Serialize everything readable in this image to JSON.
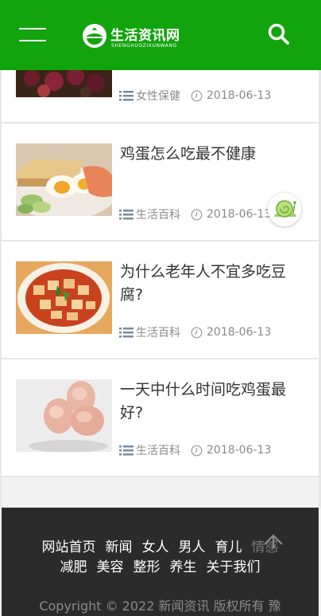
{
  "header": {
    "logo_title": "生活资讯网",
    "logo_subtitle": "SHENGHUOZIXUNWANG",
    "brand_color": "#12a40c",
    "menu_icon": "hamburger-menu-icon",
    "search_icon": "search-icon"
  },
  "articles": [
    {
      "title": "",
      "category": "女性保健",
      "date": "2018-06-13",
      "thumb": "berries-photo"
    },
    {
      "title": "鸡蛋怎么吃最不健康",
      "category": "生活百科",
      "date": "2018-06-13",
      "thumb": "eggs-toast-photo"
    },
    {
      "title": "为什么老年人不宜多吃豆腐?",
      "category": "生活百科",
      "date": "2018-06-13",
      "thumb": "mapo-tofu-photo"
    },
    {
      "title": "一天中什么时间吃鸡蛋最好?",
      "category": "生活百科",
      "date": "2018-06-13",
      "thumb": "raw-eggs-photo"
    }
  ],
  "footer": {
    "nav_row1": [
      "网站首页",
      "新闻",
      "女人",
      "男人",
      "育儿",
      "情感"
    ],
    "nav_row2": [
      "减肥",
      "美容",
      "整形",
      "养生",
      "关于我们"
    ],
    "copyright": "Copyright © 2022 新闻资讯 版权所有 豫"
  }
}
